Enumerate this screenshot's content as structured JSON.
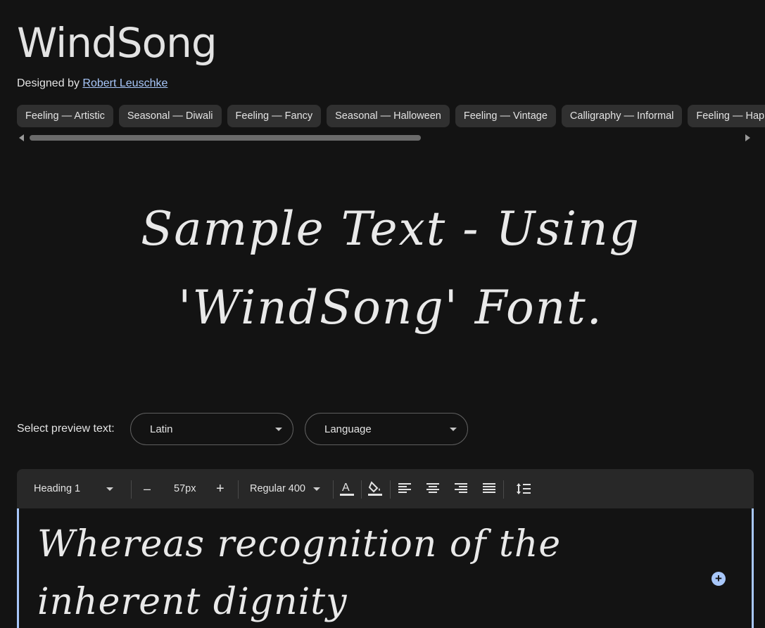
{
  "font": {
    "title": "WindSong",
    "designed_by_label": "Designed by",
    "designer_name": "Robert Leuschke"
  },
  "tags": [
    "Feeling — Artistic",
    "Seasonal — Diwali",
    "Feeling — Fancy",
    "Seasonal — Halloween",
    "Feeling — Vintage",
    "Calligraphy — Informal",
    "Feeling — Happy"
  ],
  "hero_preview": "Sample Text - Using 'WindSong' Font.",
  "preview_controls": {
    "label": "Select preview text:",
    "script_select": "Latin",
    "language_select": "Language"
  },
  "toolbar": {
    "style_select": "Heading 1",
    "decrease_symbol": "–",
    "size_value": "57px",
    "increase_symbol": "+",
    "weight_select": "Regular 400"
  },
  "editor": {
    "text": "Whereas recognition of the inherent dignity"
  },
  "colors": {
    "background": "#131313",
    "toolbar": "#282828",
    "accent": "#a8c7fa",
    "chip": "#303030"
  }
}
